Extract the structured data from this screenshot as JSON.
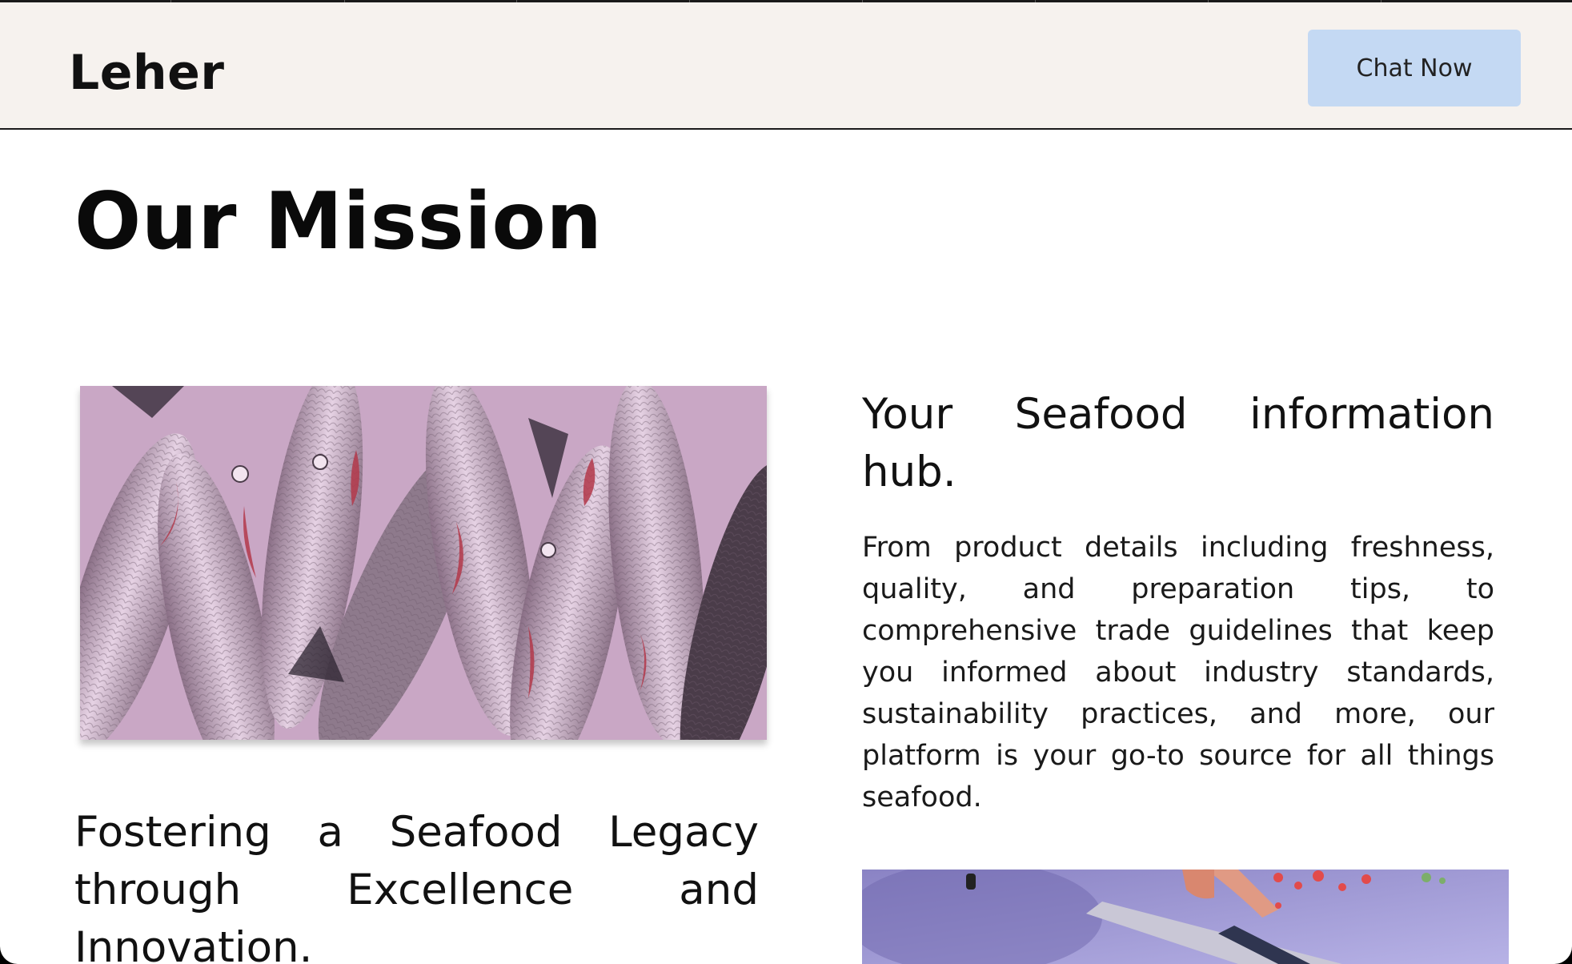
{
  "navbar": {
    "brand": "Leher",
    "cta_label": "Chat Now",
    "background": "#f6f2ee",
    "cta_color": "#c4d9f3"
  },
  "main": {
    "title": "Our Mission",
    "left_heading": "Fostering a Seafood Legacy through Excellence and Innovation.",
    "right_heading": "Your Seafood information hub.",
    "right_paragraph": "From product details including freshness, quality, and preparation tips, to comprehensive trade guidelines that keep you informed about industry standards, sustainability practices, and more, our platform is your go-to source for all things seafood."
  },
  "images": {
    "fish": "fish-pile-image",
    "knife": "knife-cutting-image"
  }
}
